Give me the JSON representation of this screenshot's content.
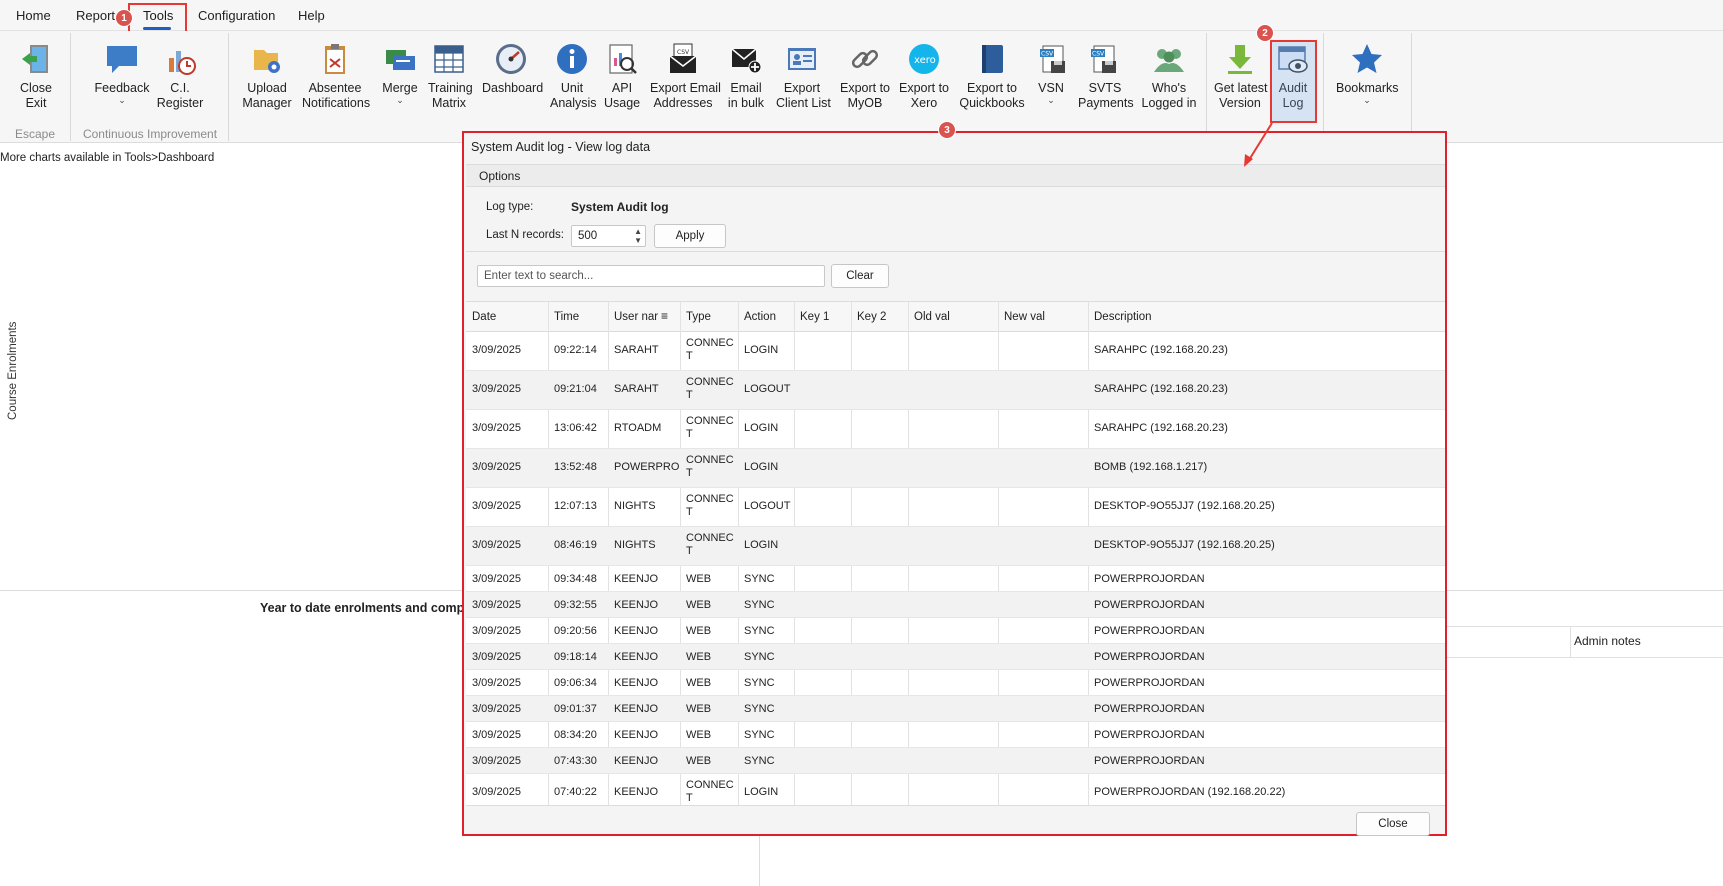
{
  "menu": {
    "home": "Home",
    "reports": "Reports",
    "tools": "Tools",
    "configuration": "Configuration",
    "help": "Help"
  },
  "ribbon": {
    "close_exit": "Close\nExit",
    "feedback": "Feedback",
    "ci_register": "C.I.\nRegister",
    "upload_manager": "Upload\nManager",
    "absentee": "Absentee\nNotifications",
    "merge": "Merge",
    "training_matrix": "Training\nMatrix",
    "dashboard": "Dashboard",
    "unit_analysis": "Unit\nAnalysis",
    "api_usage": "API\nUsage",
    "export_email": "Export Email\nAddresses",
    "email_bulk": "Email\nin bulk",
    "export_client": "Export\nClient List",
    "export_myob": "Export to\nMyOB",
    "export_xero": "Export to\nXero",
    "export_qb": "Export to\nQuickbooks",
    "vsn": "VSN",
    "svts": "SVTS\nPayments",
    "whos_logged": "Who's\nLogged in",
    "get_latest": "Get latest\nVersion",
    "audit_log": "Audit\nLog",
    "bookmarks": "Bookmarks",
    "grp_escape": "Escape",
    "grp_ci": "Continuous Improvement"
  },
  "badges": {
    "b1": "1",
    "b2": "2",
    "b3": "3"
  },
  "background": {
    "info": "More charts available in Tools>Dashboard",
    "vertical_label": "Course Enrolments",
    "chart_title": "Year to date enrolments and comple",
    "admin_notes": "Admin notes"
  },
  "dialog": {
    "title": "System Audit log - View log data",
    "options": "Options",
    "log_type_label": "Log type:",
    "log_type_value": "System Audit log",
    "last_n_label": "Last N records:",
    "last_n_value": "500",
    "apply": "Apply",
    "search_placeholder": "Enter text to search...",
    "clear": "Clear",
    "close": "Close",
    "columns": [
      "Date",
      "Time",
      "User nar",
      "Type",
      "Action",
      "Key 1",
      "Key 2",
      "Old val",
      "New val",
      "Description"
    ],
    "rows": [
      {
        "date": "3/09/2025",
        "time": "09:22:14",
        "user": "SARAHT",
        "type": "CONNECT",
        "action": "LOGIN",
        "desc": "SARAHPC (192.168.20.23)"
      },
      {
        "date": "3/09/2025",
        "time": "09:21:04",
        "user": "SARAHT",
        "type": "CONNECT",
        "action": "LOGOUT",
        "desc": "SARAHPC (192.168.20.23)"
      },
      {
        "date": "3/09/2025",
        "time": "13:06:42",
        "user": "RTOADM",
        "type": "CONNECT",
        "action": "LOGIN",
        "desc": "SARAHPC (192.168.20.23)"
      },
      {
        "date": "3/09/2025",
        "time": "13:52:48",
        "user": "POWERPRO",
        "type": "CONNECT",
        "action": "LOGIN",
        "desc": "BOMB (192.168.1.217)"
      },
      {
        "date": "3/09/2025",
        "time": "12:07:13",
        "user": "NIGHTS",
        "type": "CONNECT",
        "action": "LOGOUT",
        "desc": "DESKTOP-9O55JJ7 (192.168.20.25)"
      },
      {
        "date": "3/09/2025",
        "time": "08:46:19",
        "user": "NIGHTS",
        "type": "CONNECT",
        "action": "LOGIN",
        "desc": "DESKTOP-9O55JJ7 (192.168.20.25)"
      },
      {
        "date": "3/09/2025",
        "time": "09:34:48",
        "user": "KEENJO",
        "type": "WEB",
        "action": "SYNC",
        "desc": "POWERPROJORDAN"
      },
      {
        "date": "3/09/2025",
        "time": "09:32:55",
        "user": "KEENJO",
        "type": "WEB",
        "action": "SYNC",
        "desc": "POWERPROJORDAN"
      },
      {
        "date": "3/09/2025",
        "time": "09:20:56",
        "user": "KEENJO",
        "type": "WEB",
        "action": "SYNC",
        "desc": "POWERPROJORDAN"
      },
      {
        "date": "3/09/2025",
        "time": "09:18:14",
        "user": "KEENJO",
        "type": "WEB",
        "action": "SYNC",
        "desc": "POWERPROJORDAN"
      },
      {
        "date": "3/09/2025",
        "time": "09:06:34",
        "user": "KEENJO",
        "type": "WEB",
        "action": "SYNC",
        "desc": "POWERPROJORDAN"
      },
      {
        "date": "3/09/2025",
        "time": "09:01:37",
        "user": "KEENJO",
        "type": "WEB",
        "action": "SYNC",
        "desc": "POWERPROJORDAN"
      },
      {
        "date": "3/09/2025",
        "time": "08:34:20",
        "user": "KEENJO",
        "type": "WEB",
        "action": "SYNC",
        "desc": "POWERPROJORDAN"
      },
      {
        "date": "3/09/2025",
        "time": "07:43:30",
        "user": "KEENJO",
        "type": "WEB",
        "action": "SYNC",
        "desc": "POWERPROJORDAN"
      },
      {
        "date": "3/09/2025",
        "time": "07:40:22",
        "user": "KEENJO",
        "type": "CONNECT",
        "action": "LOGIN",
        "desc": "POWERPROJORDAN (192.168.20.22)"
      }
    ]
  },
  "colors": {
    "highlight_red": "#e53935",
    "badge_red": "#d9534f",
    "accent_blue": "#1f5fbf"
  }
}
